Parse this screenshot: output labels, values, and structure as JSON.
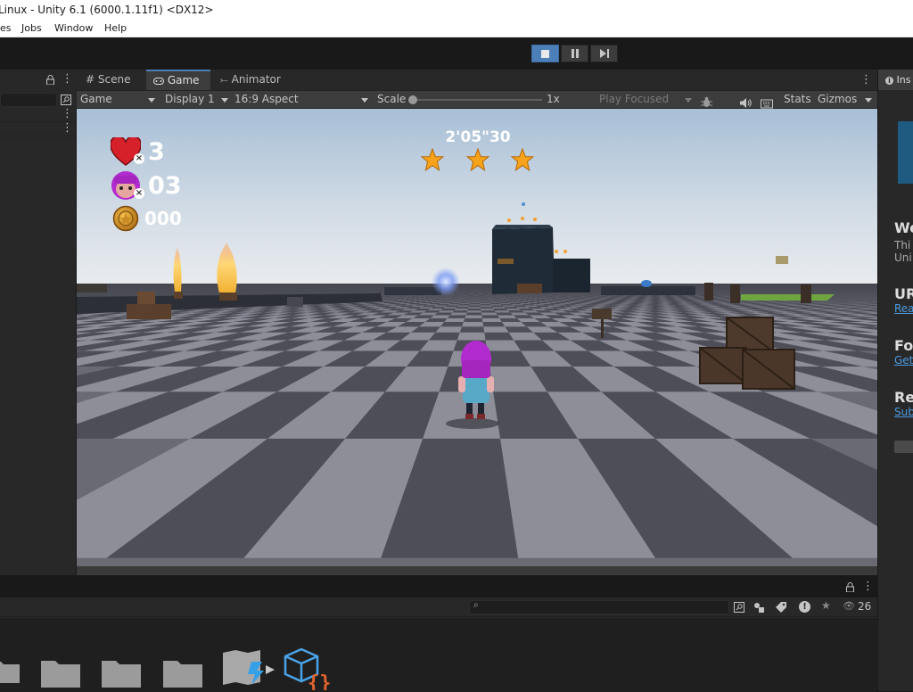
{
  "window": {
    "title": "Linux - Unity 6.1 (6000.1.11f1) <DX12>"
  },
  "menu": {
    "items": [
      "es",
      "Jobs",
      "Window",
      "Help"
    ]
  },
  "tabs": {
    "scene": "Scene",
    "game": "Game",
    "animator": "Animator",
    "inspector": "Ins"
  },
  "gamebar": {
    "mode": "Game",
    "display": "Display 1",
    "aspect": "16:9 Aspect",
    "scale_label": "Scale",
    "scale_value": "1x",
    "play_focused": "Play Focused",
    "stats": "Stats",
    "gizmos": "Gizmos"
  },
  "hud": {
    "timer": "2'05\"30",
    "lives": "3",
    "character_count": "03",
    "coins": "000",
    "stars": 3
  },
  "inspector": {
    "sections": [
      {
        "heading": "We",
        "lines": [
          "Thi",
          "Uni"
        ]
      },
      {
        "heading": "UR",
        "link": "Rea"
      },
      {
        "heading": "Fo",
        "link": "Get"
      },
      {
        "heading": "Re",
        "link": "Sub"
      }
    ]
  },
  "project": {
    "hidden_count": "26"
  },
  "colors": {
    "accent": "#4c7fb8",
    "panel": "#282828",
    "toolbar": "#3c3c3c",
    "sky_top": "#aec3d8",
    "floor_light": "#8e8e99",
    "floor_dark": "#4e4e58"
  }
}
